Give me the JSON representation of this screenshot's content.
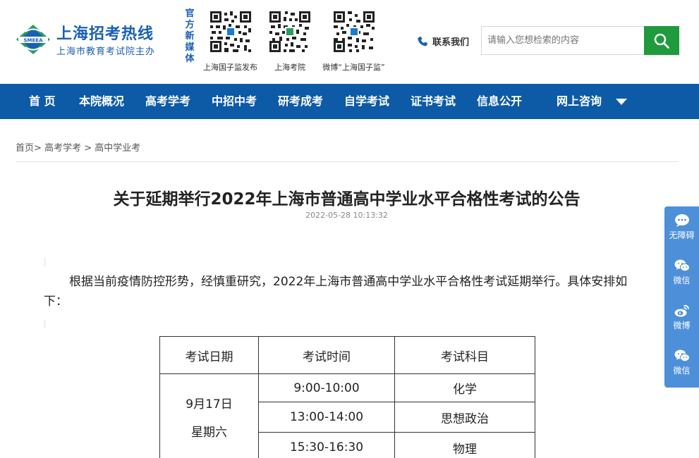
{
  "header": {
    "logo_title": "上海招考热线",
    "logo_subtitle": "上海市教育考试院主办",
    "logo_badge_text": "SMEEA",
    "media_label": "官方新媒体",
    "qr_codes": [
      {
        "caption": "上海国子监发布"
      },
      {
        "caption": "上海考院"
      },
      {
        "caption": "微博“上海国子监”"
      }
    ],
    "contact_label": "联系我们",
    "search_placeholder": "请输入您想检索的内容",
    "brand_color": "#1a5fb4",
    "search_button_color": "#1f9a3c"
  },
  "nav": {
    "background": "#0d5aa7",
    "items": [
      "首 页",
      "本院概况",
      "高考学考",
      "中招中考",
      "研考成考",
      "自学考试",
      "证书考试",
      "信息公开",
      "网上咨询"
    ]
  },
  "breadcrumb": {
    "items": [
      "首页",
      "高考学考",
      "高中学业考"
    ],
    "separator": ">"
  },
  "article": {
    "title": "关于延期举行2022年上海市普通高中学业水平合格性考试的公告",
    "timestamp": "2022-05-28 10:13:32",
    "paragraph": "根据当前疫情防控形势，经慎重研究，2022年上海市普通高中学业水平合格性考试延期举行。具体安排如下："
  },
  "schedule": {
    "headers": [
      "考试日期",
      "考试时间",
      "考试科目"
    ],
    "date": "9月17日",
    "weekday": "星期六",
    "rows": [
      {
        "time": "9:00-10:00",
        "subject": "化学"
      },
      {
        "time": "13:00-14:00",
        "subject": "思想政治"
      },
      {
        "time": "15:30-16:30",
        "subject": "物理"
      }
    ]
  },
  "sidebar": {
    "background": "#4d8fd9",
    "items": [
      {
        "label": "无障碍",
        "icon": "chat-bubble-icon"
      },
      {
        "label": "微信",
        "icon": "wechat-icon"
      },
      {
        "label": "微博",
        "icon": "weibo-icon"
      },
      {
        "label": "微信",
        "icon": "wechat-icon"
      }
    ]
  }
}
